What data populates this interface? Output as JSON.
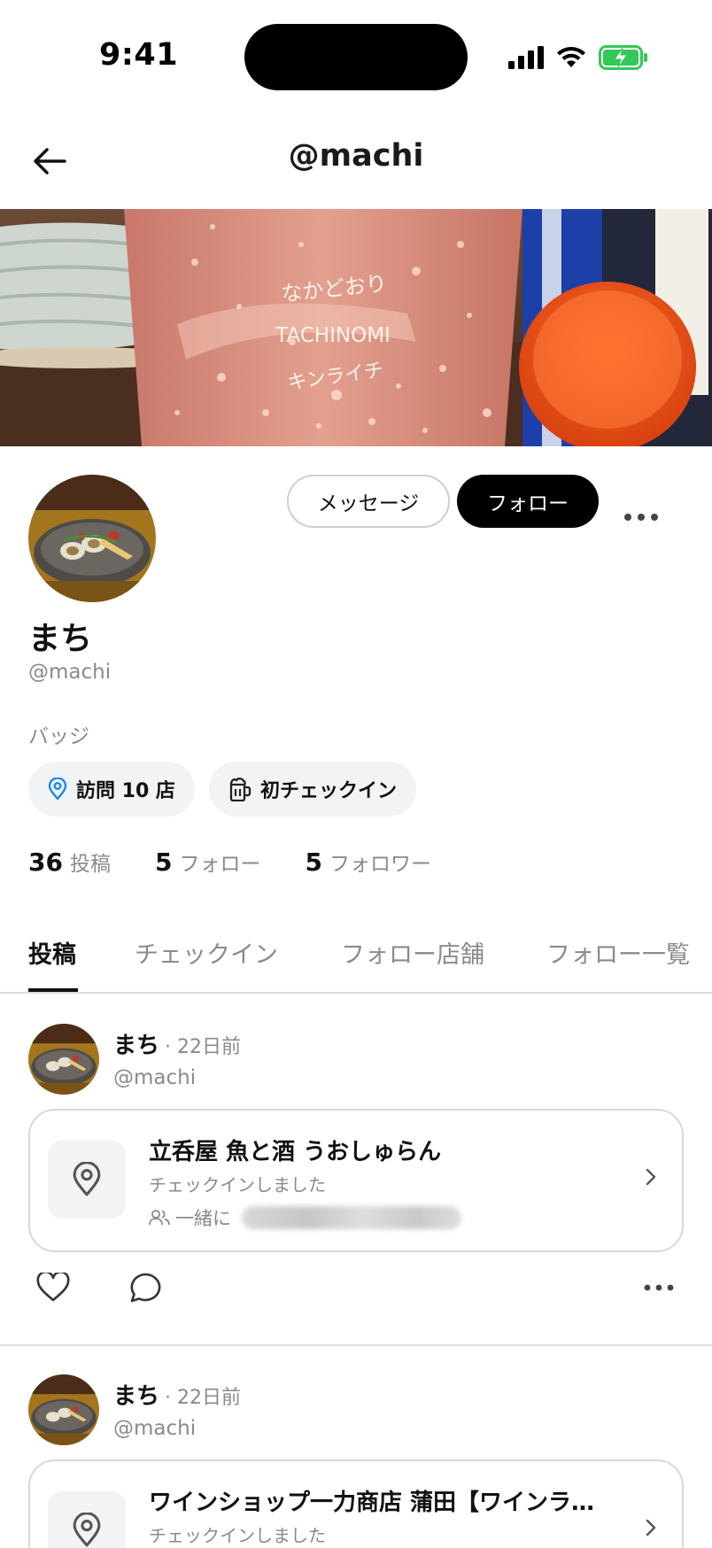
{
  "status_bar": {
    "time": "9:41",
    "battery_color": "#34c759"
  },
  "header": {
    "title": "@machi",
    "back_icon": "arrow-left-icon"
  },
  "cover": {
    "glass_text_line1": "なかどおり",
    "glass_text_line2": "TACHINOMI",
    "glass_text_line3": "キンライチ"
  },
  "profile": {
    "message_label": "メッセージ",
    "follow_label": "フォロー",
    "more_icon": "more-horizontal-icon",
    "display_name": "まち",
    "handle": "@machi",
    "badges_heading": "バッジ",
    "badges": [
      {
        "icon": "map-pin-icon",
        "label": "訪問 10 店",
        "icon_color": "#1e88e5"
      },
      {
        "icon": "beer-mug-icon",
        "label": "初チェックイン"
      }
    ],
    "stats": [
      {
        "num": "36",
        "label": "投稿"
      },
      {
        "num": "5",
        "label": "フォロー"
      },
      {
        "num": "5",
        "label": "フォロワー"
      }
    ]
  },
  "tabs": [
    {
      "label": "投稿",
      "active": true
    },
    {
      "label": "チェックイン",
      "active": false
    },
    {
      "label": "フォロー店舗",
      "active": false
    },
    {
      "label": "フォロー一覧",
      "active": false
    }
  ],
  "posts": [
    {
      "name": "まち",
      "time": "· 22日前",
      "handle": "@machi",
      "card": {
        "title": "立呑屋 魚と酒 うおしゅらん",
        "subtitle": "チェックインしました",
        "with_label": "一緒に"
      }
    },
    {
      "name": "まち",
      "time": "· 22日前",
      "handle": "@machi",
      "card": {
        "title": "ワインショップ一力商店 蒲田【ワインラ…",
        "subtitle": "チェックインしました"
      }
    }
  ]
}
